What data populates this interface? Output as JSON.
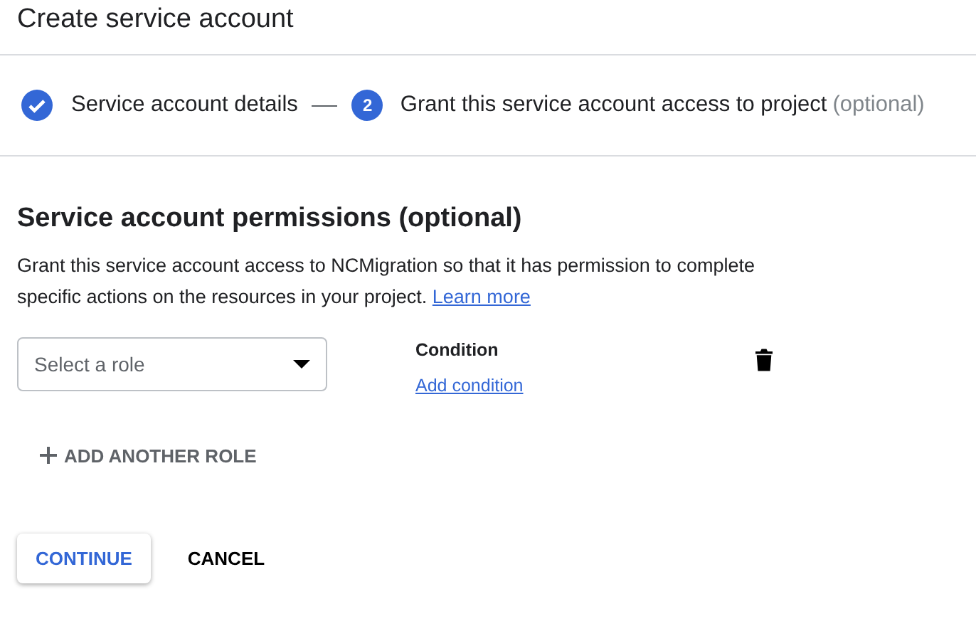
{
  "title": "Create service account",
  "steps": [
    {
      "label": "Service account details",
      "completed": true
    },
    {
      "number": "2",
      "label": "Grant this service account access to project",
      "note": "(optional)",
      "completed": false
    }
  ],
  "section": {
    "heading": "Service account permissions (optional)",
    "description": "Grant this service account access to NCMigration so that it has permission to complete specific actions on the resources in your project.",
    "link": "Learn more"
  },
  "role": {
    "placeholder": "Select a role",
    "condition_label": "Condition",
    "condition_link": "Add condition"
  },
  "add_role": "ADD ANOTHER ROLE",
  "buttons": [
    {
      "label": "CONTINUE",
      "kind": "primary"
    },
    {
      "label": "CANCEL",
      "kind": "text"
    }
  ]
}
